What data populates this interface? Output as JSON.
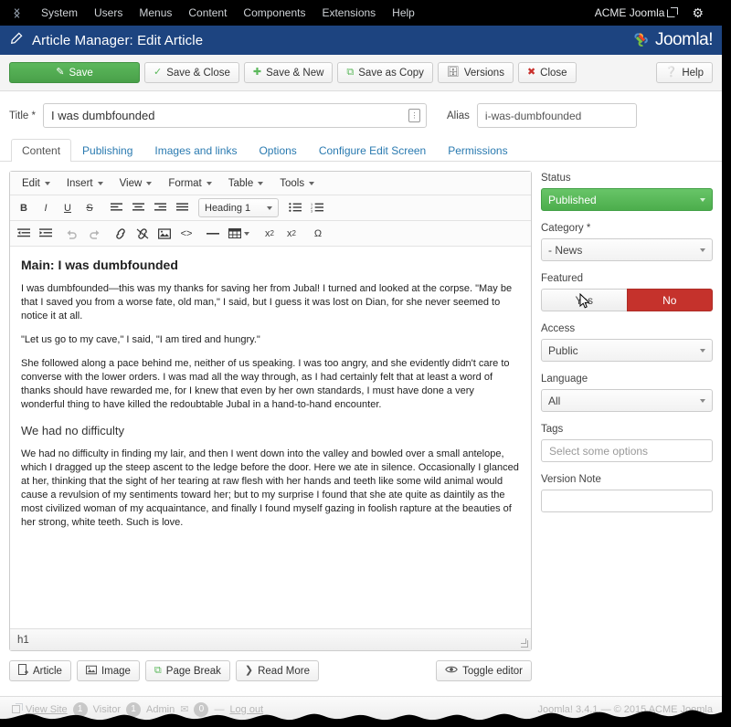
{
  "topbar": {
    "brand_icon": "joomla-mark-icon",
    "menu": [
      "System",
      "Users",
      "Menus",
      "Content",
      "Components",
      "Extensions",
      "Help"
    ],
    "site_name": "ACME Joomla",
    "site_external_icon": "external-link-icon",
    "settings_icon": "gear-icon"
  },
  "header": {
    "icon": "pencil-icon",
    "title": "Article Manager: Edit Article",
    "logo_text": "Joomla!",
    "logo_icon": "joomla-logo-icon",
    "bg_color": "#1d4480"
  },
  "toolbar": {
    "save": "Save",
    "save_close": "Save & Close",
    "save_new": "Save & New",
    "save_copy": "Save as Copy",
    "versions": "Versions",
    "close": "Close",
    "help": "Help",
    "primary_color": "#5cb85c"
  },
  "title_row": {
    "title_label": "Title *",
    "title_value": "I was dumbfounded",
    "title_badge_icon": "article-id-icon",
    "alias_label": "Alias",
    "alias_value": "i-was-dumbfounded",
    "alias_placeholder": ""
  },
  "tabs": [
    {
      "label": "Content",
      "active": true
    },
    {
      "label": "Publishing",
      "active": false
    },
    {
      "label": "Images and links",
      "active": false
    },
    {
      "label": "Options",
      "active": false
    },
    {
      "label": "Configure Edit Screen",
      "active": false
    },
    {
      "label": "Permissions",
      "active": false
    }
  ],
  "editor": {
    "menus": [
      "Edit",
      "Insert",
      "View",
      "Format",
      "Table",
      "Tools"
    ],
    "row1": [
      {
        "name": "bold-icon",
        "glyph": "B"
      },
      {
        "name": "italic-icon",
        "glyph": "I"
      },
      {
        "name": "underline-icon",
        "glyph": "U"
      },
      {
        "name": "strikethrough-icon",
        "glyph": "S"
      },
      {
        "name": "align-left-icon",
        "glyph": "≡"
      },
      {
        "name": "align-center-icon",
        "glyph": "≡"
      },
      {
        "name": "align-right-icon",
        "glyph": "≡"
      },
      {
        "name": "align-justify-icon",
        "glyph": "≡"
      }
    ],
    "format_value": "Heading 1",
    "row1_end": [
      {
        "name": "bullet-list-icon",
        "glyph": "☰"
      },
      {
        "name": "numbered-list-icon",
        "glyph": "☰"
      }
    ],
    "row2": [
      {
        "name": "outdent-icon",
        "glyph": "◧"
      },
      {
        "name": "indent-icon",
        "glyph": "◨"
      },
      {
        "name": "undo-icon",
        "glyph": "↶"
      },
      {
        "name": "redo-icon",
        "glyph": "↷"
      },
      {
        "name": "link-icon",
        "glyph": "🔗"
      },
      {
        "name": "unlink-icon",
        "glyph": "⛓"
      },
      {
        "name": "image-icon",
        "glyph": "🖼"
      },
      {
        "name": "source-code-icon",
        "glyph": "<>"
      },
      {
        "name": "horizontal-rule-icon",
        "glyph": "—"
      },
      {
        "name": "table-icon",
        "glyph": "▦"
      },
      {
        "name": "subscript-icon",
        "glyph": "x₂"
      },
      {
        "name": "superscript-icon",
        "glyph": "x²"
      },
      {
        "name": "special-character-icon",
        "glyph": "Ω"
      }
    ],
    "content": {
      "heading": "Main: I was dumbfounded",
      "p1": "I was dumbfounded—this was my thanks for saving her from Jubal! I turned and looked at the corpse. \"May be that I saved you from a worse fate, old man,\" I said, but I guess it was lost on Dian, for she never seemed to notice it at all.",
      "p2": "\"Let us go to my cave,\" I said, \"I am tired and hungry.\"",
      "p3": "She followed along a pace behind me, neither of us speaking. I was too angry, and she evidently didn't care to converse with the lower orders. I was mad all the way through, as I had certainly felt that at least a word of thanks should have rewarded me, for I knew that even by her own standards, I must have done a very wonderful thing to have killed the redoubtable Jubal in a hand-to-hand encounter.",
      "subheading": "We had no difficulty",
      "p4": "We had no difficulty in finding my lair, and then I went down into the valley and bowled over a small antelope, which I dragged up the steep ascent to the ledge before the door. Here we ate in silence. Occasionally I glanced at her, thinking that the sight of her tearing at raw flesh with her hands and teeth like some wild animal would cause a revulsion of my sentiments toward her; but to my surprise I found that she ate quite as daintily as the most civilized woman of my acquaintance, and finally I found myself gazing in foolish rapture at the beauties of her strong, white teeth. Such is love."
    },
    "status_path": "h1"
  },
  "editor_buttons": {
    "article": "Article",
    "image": "Image",
    "page_break": "Page Break",
    "read_more": "Read More",
    "toggle_editor": "Toggle editor"
  },
  "sidebar": {
    "status_label": "Status",
    "status_value": "Published",
    "status_color": "#4cae4c",
    "category_label": "Category *",
    "category_value": "- News",
    "featured_label": "Featured",
    "featured_yes": "Yes",
    "featured_no": "No",
    "featured_selected": "No",
    "featured_no_color": "#c5322c",
    "access_label": "Access",
    "access_value": "Public",
    "language_label": "Language",
    "language_value": "All",
    "tags_label": "Tags",
    "tags_placeholder": "Select some options",
    "tags_value": "",
    "version_note_label": "Version Note",
    "version_note_value": ""
  },
  "footer": {
    "view_site": "View Site",
    "visitor_count": "1",
    "visitor_label": "Visitor",
    "admin_count": "1",
    "admin_label": "Admin",
    "message_icon": "envelope-icon",
    "message_count": "0",
    "log_out": "Log out",
    "version": "Joomla! 3.4.1  —  © 2015 ACME Joomla"
  }
}
